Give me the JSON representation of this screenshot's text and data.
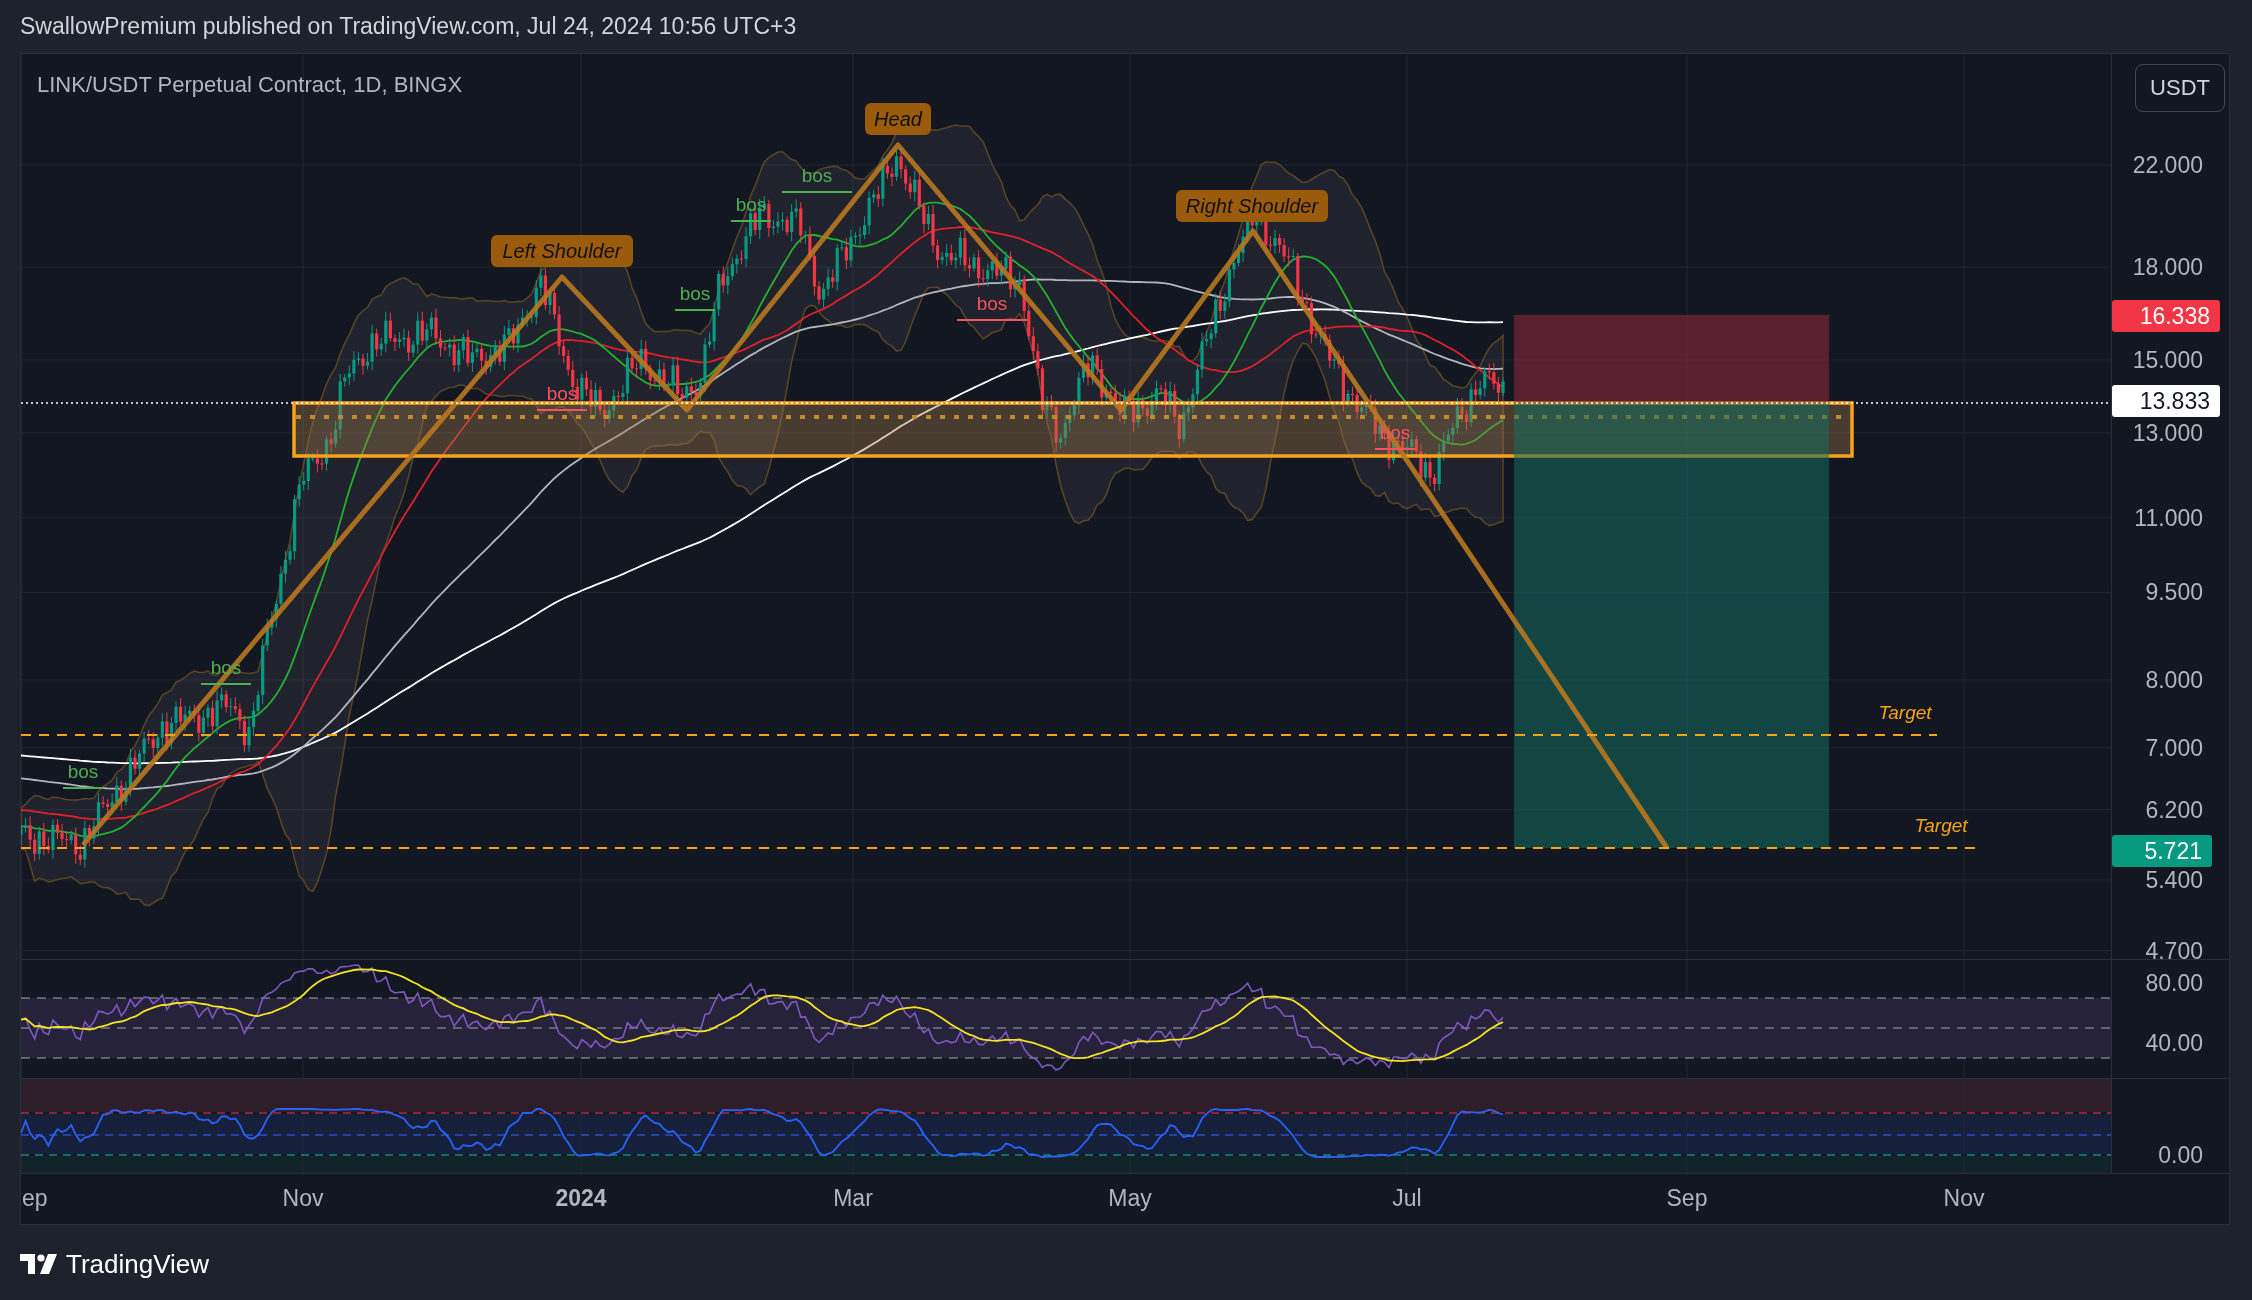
{
  "header": {
    "text": "SwallowPremium published on TradingView.com, Jul 24, 2024 10:56 UTC+3"
  },
  "chart": {
    "title": "LINK/USDT Perpetual Contract, 1D, BINGX",
    "currency_button": "USDT",
    "pattern_labels": [
      {
        "text": "Left Shoulder"
      },
      {
        "text": "Head"
      },
      {
        "text": "Right Shoulder"
      }
    ],
    "bos_labels": [
      {
        "text": "bos",
        "kind": "bullish"
      },
      {
        "text": "bos",
        "kind": "bullish"
      },
      {
        "text": "bos",
        "kind": "bearish"
      },
      {
        "text": "bos",
        "kind": "bullish"
      },
      {
        "text": "bos",
        "kind": "bullish"
      },
      {
        "text": "bos",
        "kind": "bullish"
      },
      {
        "text": "bos",
        "kind": "bearish"
      },
      {
        "text": "bos",
        "kind": "bearish"
      }
    ],
    "target_labels": [
      {
        "text": "Target"
      },
      {
        "text": "Target"
      }
    ],
    "price_axis": [
      "22.000",
      "18.000",
      "15.000",
      "13.000",
      "11.000",
      "9.500",
      "8.000",
      "7.000",
      "6.200",
      "5.400",
      "4.700"
    ],
    "price_tags": [
      {
        "text": "16.338",
        "kind": "stop"
      },
      {
        "text": "13.833",
        "kind": "last"
      },
      {
        "text": "5.721",
        "kind": "target"
      }
    ],
    "rsi_axis": [
      "80.00",
      "40.00"
    ],
    "oscillator_axis": [
      "0.00"
    ],
    "time_axis": [
      {
        "text": "ep",
        "kind": "month"
      },
      {
        "text": "Nov",
        "kind": "month"
      },
      {
        "text": "2024",
        "kind": "year"
      },
      {
        "text": "Mar",
        "kind": "month"
      },
      {
        "text": "May",
        "kind": "month"
      },
      {
        "text": "Jul",
        "kind": "month"
      },
      {
        "text": "Sep",
        "kind": "month"
      },
      {
        "text": "Nov",
        "kind": "month"
      }
    ]
  },
  "footer": {
    "logo_text": "TradingView"
  }
}
